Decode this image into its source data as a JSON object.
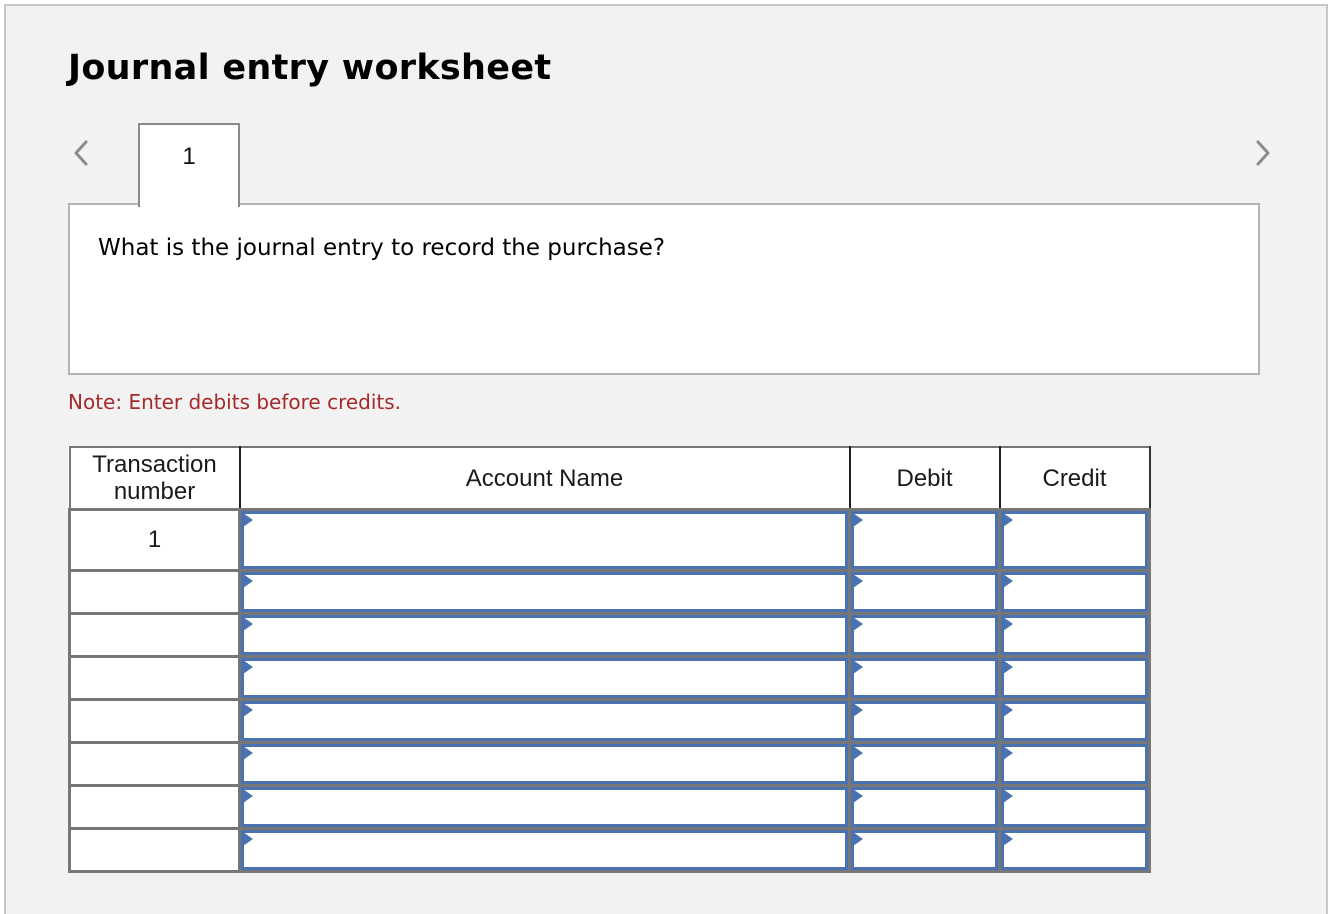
{
  "header": {
    "title": "Journal entry worksheet"
  },
  "navigation": {
    "prev_icon": "chevron-left-icon",
    "next_icon": "chevron-right-icon",
    "tabs": [
      {
        "label": "1",
        "active": true
      }
    ]
  },
  "question": {
    "text": "What is the journal entry to record the purchase?"
  },
  "note": {
    "text": "Note: Enter debits before credits.",
    "color": "#a52a2a"
  },
  "table": {
    "columns": {
      "transaction": "Transaction number",
      "account": "Account Name",
      "debit": "Debit",
      "credit": "Credit"
    },
    "rows": [
      {
        "transaction": "1",
        "account": "",
        "debit": "",
        "credit": ""
      },
      {
        "transaction": "",
        "account": "",
        "debit": "",
        "credit": ""
      },
      {
        "transaction": "",
        "account": "",
        "debit": "",
        "credit": ""
      },
      {
        "transaction": "",
        "account": "",
        "debit": "",
        "credit": ""
      },
      {
        "transaction": "",
        "account": "",
        "debit": "",
        "credit": ""
      },
      {
        "transaction": "",
        "account": "",
        "debit": "",
        "credit": ""
      },
      {
        "transaction": "",
        "account": "",
        "debit": "",
        "credit": ""
      },
      {
        "transaction": "",
        "account": "",
        "debit": "",
        "credit": ""
      }
    ],
    "input_marker_icon": "dropdown-triangle-icon",
    "input_border_color": "#4a72b0"
  }
}
